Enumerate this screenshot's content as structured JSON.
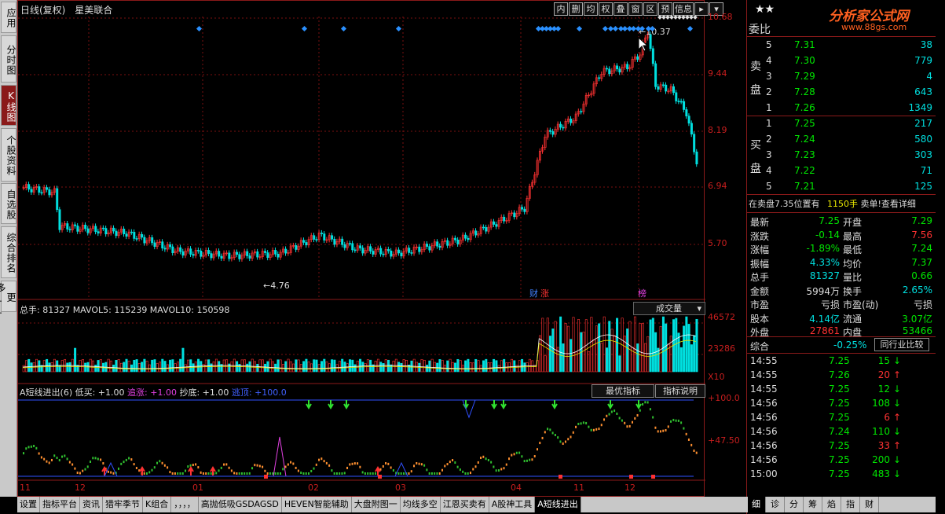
{
  "left_tabs": [
    {
      "label": "应用",
      "active": false
    },
    {
      "label": "分时图",
      "active": false
    },
    {
      "label": "K线图",
      "active": true
    },
    {
      "label": "个股资料",
      "active": false
    },
    {
      "label": "自选股",
      "active": false
    },
    {
      "label": "综合排名",
      "active": false
    },
    {
      "label": "更多..",
      "active": false
    }
  ],
  "header": {
    "period": "日线(复权)",
    "stock": "星美联合"
  },
  "toolbar": [
    "内",
    "删",
    "均",
    "权",
    "叠",
    "窗",
    "区",
    "预",
    "信息",
    "▸",
    "▾"
  ],
  "price_axis": [
    "10.68",
    "9.44",
    "8.19",
    "6.94",
    "5.70"
  ],
  "annotations": {
    "high": "10.37",
    "low": "4.76",
    "tag_cai": "财",
    "tag_zhang": "涨",
    "tag_bang": "榜"
  },
  "volume_panel": {
    "title": "总手: 81327 MAVOL5: 115239 MAVOL10: 150598",
    "selector": "成交量",
    "axis": [
      "46572",
      "23286"
    ],
    "unit": "X10"
  },
  "indicator_panel": {
    "name": "A短线进出(6)",
    "low_buy": "低买: +1.00",
    "chase": "追涨: +1.00",
    "bottom": "抄底: +1.00",
    "escape": "逃顶: +100.0",
    "btn_best": "最优指标",
    "btn_explain": "指标说明",
    "axis": [
      "+100.0",
      "+47.50"
    ]
  },
  "x_labels": [
    "11",
    "12",
    "01",
    "02",
    "03",
    "04",
    "11",
    "12"
  ],
  "right_panel": {
    "logo": "分析家公式网",
    "logo_url": "www.88gs.com",
    "weibi_label": "委比",
    "sell_label": "卖盘",
    "buy_label": "买盘",
    "sell": [
      {
        "n": "5",
        "p": "7.31",
        "v": "38"
      },
      {
        "n": "4",
        "p": "7.30",
        "v": "779"
      },
      {
        "n": "3",
        "p": "7.29",
        "v": "4"
      },
      {
        "n": "2",
        "p": "7.28",
        "v": "643"
      },
      {
        "n": "1",
        "p": "7.26",
        "v": "1349"
      }
    ],
    "buy": [
      {
        "n": "1",
        "p": "7.25",
        "v": "217"
      },
      {
        "n": "2",
        "p": "7.24",
        "v": "580"
      },
      {
        "n": "3",
        "p": "7.23",
        "v": "303"
      },
      {
        "n": "4",
        "p": "7.22",
        "v": "71"
      },
      {
        "n": "5",
        "p": "7.21",
        "v": "125"
      }
    ],
    "notice_left": "在卖盘7.35位置有",
    "notice_vol": "1150手",
    "notice_right": "卖单!查看详细",
    "stats": [
      [
        "最新",
        "7.25",
        "开盘",
        "7.29"
      ],
      [
        "涨跌",
        "-0.14",
        "最高",
        "7.56"
      ],
      [
        "涨幅",
        "-1.89%",
        "最低",
        "7.24"
      ],
      [
        "振幅",
        "4.33%",
        "均价",
        "7.37"
      ],
      [
        "总手",
        "81327",
        "量比",
        "0.66"
      ],
      [
        "金额",
        "5994万",
        "换手",
        "2.65%"
      ],
      [
        "市盈",
        "亏损",
        "市盈(动)",
        "亏损"
      ],
      [
        "股本",
        "4.14亿",
        "流通",
        "3.07亿"
      ],
      [
        "外盘",
        "27861",
        "内盘",
        "53466"
      ]
    ],
    "composite": "综合",
    "composite_val": "-0.25%",
    "industry_btn": "同行业比较",
    "ticks": [
      [
        "14:55",
        "7.25",
        "15",
        "down"
      ],
      [
        "14:55",
        "7.26",
        "20",
        "up"
      ],
      [
        "14:55",
        "7.25",
        "12",
        "down"
      ],
      [
        "14:56",
        "7.25",
        "108",
        "down"
      ],
      [
        "14:56",
        "7.25",
        "6",
        "up"
      ],
      [
        "14:56",
        "7.24",
        "110",
        "down"
      ],
      [
        "14:56",
        "7.25",
        "33",
        "up"
      ],
      [
        "14:56",
        "7.25",
        "200",
        "down"
      ],
      [
        "15:00",
        "7.25",
        "483",
        "down"
      ]
    ],
    "bottom_tabs": [
      "细",
      "诊",
      "分",
      "筹",
      "焰",
      "指",
      "财"
    ]
  },
  "bottom_tabs": [
    "设置",
    "指标平台",
    "资讯",
    "猎牢季节",
    "K组合",
    "，，，，",
    "高抛低吸GSDAGSD",
    "HEVEN智能辅助",
    "大盘附图一",
    "均线多空",
    "江恩买卖有",
    "A股神工具",
    "A短线进出"
  ],
  "colors": {
    "up": "#ff3232",
    "down": "#00e0e0",
    "grid": "#7a1010"
  }
}
